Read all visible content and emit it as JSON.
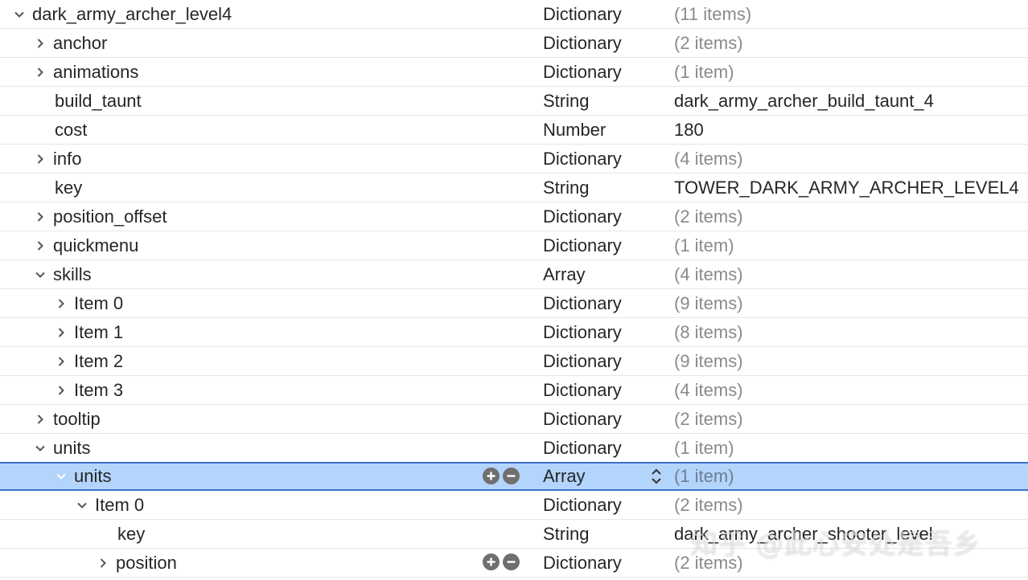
{
  "rows": [
    {
      "key": "dark_army_archer_level4",
      "type": "Dictionary",
      "value": "(11 items)"
    },
    {
      "key": "anchor",
      "type": "Dictionary",
      "value": "(2 items)"
    },
    {
      "key": "animations",
      "type": "Dictionary",
      "value": "(1 item)"
    },
    {
      "key": "build_taunt",
      "type": "String",
      "value": "dark_army_archer_build_taunt_4"
    },
    {
      "key": "cost",
      "type": "Number",
      "value": "180"
    },
    {
      "key": "info",
      "type": "Dictionary",
      "value": "(4 items)"
    },
    {
      "key": "key",
      "type": "String",
      "value": "TOWER_DARK_ARMY_ARCHER_LEVEL4"
    },
    {
      "key": "position_offset",
      "type": "Dictionary",
      "value": "(2 items)"
    },
    {
      "key": "quickmenu",
      "type": "Dictionary",
      "value": "(1 item)"
    },
    {
      "key": "skills",
      "type": "Array",
      "value": "(4 items)"
    },
    {
      "key": "Item 0",
      "type": "Dictionary",
      "value": "(9 items)"
    },
    {
      "key": "Item 1",
      "type": "Dictionary",
      "value": "(8 items)"
    },
    {
      "key": "Item 2",
      "type": "Dictionary",
      "value": "(9 items)"
    },
    {
      "key": "Item 3",
      "type": "Dictionary",
      "value": "(4 items)"
    },
    {
      "key": "tooltip",
      "type": "Dictionary",
      "value": "(2 items)"
    },
    {
      "key": "units",
      "type": "Dictionary",
      "value": "(1 item)"
    },
    {
      "key": "units",
      "type": "Array",
      "value": "(1 item)"
    },
    {
      "key": "Item 0",
      "type": "Dictionary",
      "value": "(2 items)"
    },
    {
      "key": "key",
      "type": "String",
      "value": "dark_army_archer_shooter_level"
    },
    {
      "key": "position",
      "type": "Dictionary",
      "value": "(2 items)"
    }
  ],
  "watermark": "知乎 @此心安处是吾乡",
  "colors": {
    "selection": "#b3d4fb",
    "selection_border": "#3d72c4",
    "count_text": "#8a8a8a"
  },
  "icons": {
    "collapsed": "chevron-right-icon",
    "expanded": "chevron-down-icon",
    "add": "plus-circle-icon",
    "remove": "minus-circle-icon",
    "stepper": "up-down-stepper-icon"
  }
}
